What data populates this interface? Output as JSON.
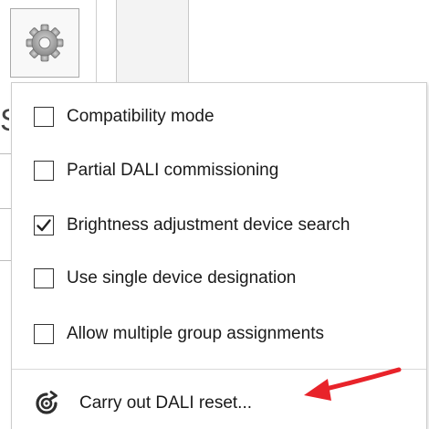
{
  "toolbar": {
    "settings_icon": "gear-icon",
    "background_letter": "S"
  },
  "menu": {
    "items": [
      {
        "label": "Compatibility mode",
        "checked": false
      },
      {
        "label": "Partial DALI commissioning",
        "checked": false
      },
      {
        "label": "Brightness adjustment device search",
        "checked": true
      },
      {
        "label": "Use single device designation",
        "checked": false
      },
      {
        "label": "Allow multiple group assignments",
        "checked": false
      }
    ],
    "reset": {
      "label": "Carry out DALI reset...",
      "icon": "reset-icon"
    }
  },
  "annotation": {
    "arrow_color": "#e8232a"
  }
}
